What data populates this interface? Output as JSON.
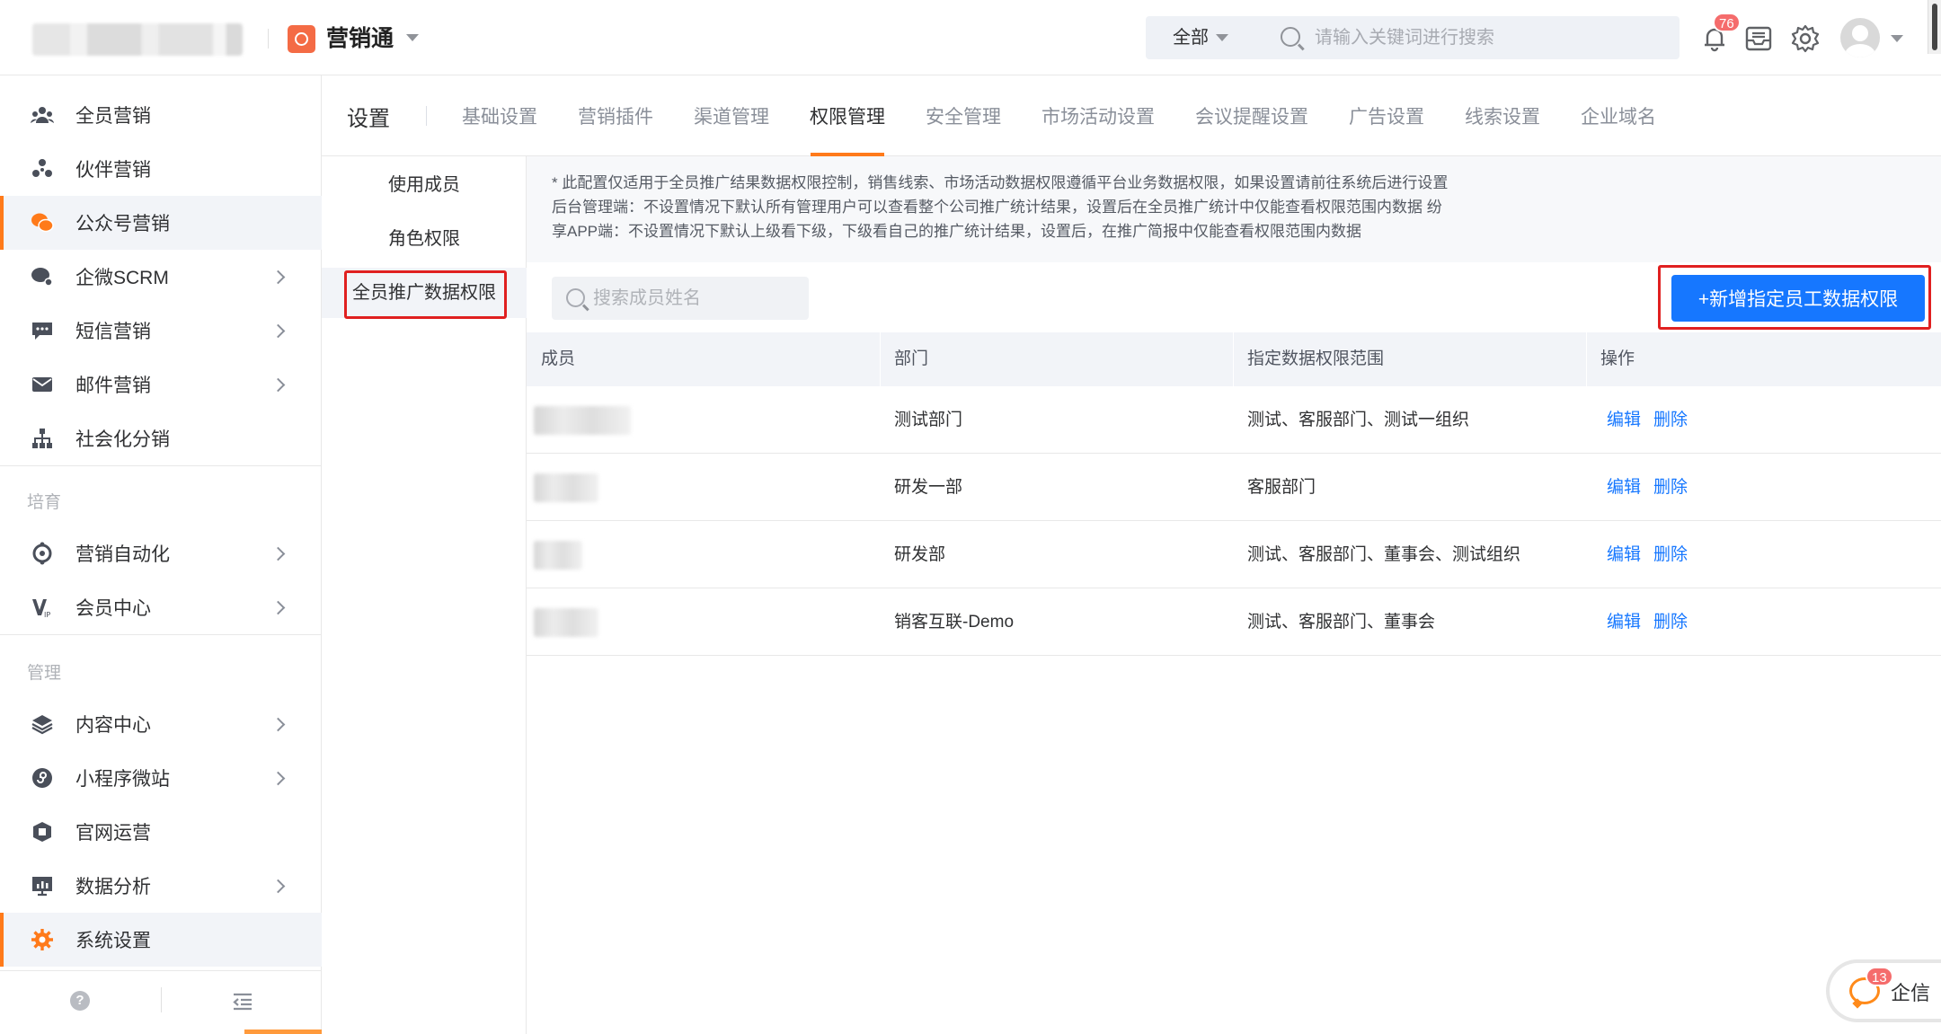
{
  "header": {
    "app_name": "营销通",
    "search": {
      "scope": "全部",
      "placeholder": "请输入关键词进行搜索"
    },
    "notification_count": "76"
  },
  "sidebar": {
    "items": [
      {
        "label": "全员营销",
        "icon": "people-group-icon",
        "has_arrow": false
      },
      {
        "label": "伙伴营销",
        "icon": "partner-network-icon",
        "has_arrow": false
      },
      {
        "label": "公众号营销",
        "icon": "wechat-icon",
        "has_arrow": false,
        "active": true
      },
      {
        "label": "企微SCRM",
        "icon": "wecom-chat-icon",
        "has_arrow": true
      },
      {
        "label": "短信营销",
        "icon": "sms-icon",
        "has_arrow": true
      },
      {
        "label": "邮件营销",
        "icon": "mail-icon",
        "has_arrow": true
      },
      {
        "label": "社会化分销",
        "icon": "hierarchy-icon",
        "has_arrow": false
      }
    ],
    "group_nurture": "培育",
    "nurture_items": [
      {
        "label": "营销自动化",
        "icon": "automation-icon",
        "has_arrow": true
      },
      {
        "label": "会员中心",
        "icon": "vip-icon",
        "has_arrow": true
      }
    ],
    "group_manage": "管理",
    "manage_items": [
      {
        "label": "内容中心",
        "icon": "layers-icon",
        "has_arrow": true
      },
      {
        "label": "小程序微站",
        "icon": "miniprogram-icon",
        "has_arrow": true
      },
      {
        "label": "官网运营",
        "icon": "website-icon",
        "has_arrow": false
      },
      {
        "label": "数据分析",
        "icon": "monitor-chart-icon",
        "has_arrow": true
      },
      {
        "label": "系统设置",
        "icon": "gear-icon",
        "has_arrow": false,
        "active": true
      }
    ]
  },
  "tabs": {
    "title": "设置",
    "items": [
      "基础设置",
      "营销插件",
      "渠道管理",
      "权限管理",
      "安全管理",
      "市场活动设置",
      "会议提醒设置",
      "广告设置",
      "线索设置",
      "企业域名"
    ],
    "active": "权限管理"
  },
  "submenu": {
    "items": [
      "使用成员",
      "角色权限",
      "全员推广数据权限"
    ],
    "active": "全员推广数据权限"
  },
  "notice": {
    "lines": [
      "* 此配置仅适用于全员推广结果数据权限控制，销售线索、市场活动数据权限遵循平台业务数据权限，如果设置请前往系统后进行设置",
      "后台管理端：不设置情况下默认所有管理用户可以查看整个公司推广统计结果，设置后在全员推广统计中仅能查看权限范围内数据 纷",
      "享APP端：不设置情况下默认上级看下级，下级看自己的推广统计结果，设置后，在推广简报中仅能查看权限范围内数据"
    ]
  },
  "toolbar": {
    "member_search_placeholder": "搜索成员姓名",
    "add_button": "+新增指定员工数据权限"
  },
  "table": {
    "columns": [
      "成员",
      "部门",
      "指定数据权限范围",
      "操作"
    ],
    "rows": [
      {
        "member": "",
        "dept": "测试部门",
        "scope": "测试、客服部门、测试一组织"
      },
      {
        "member": "",
        "dept": "研发一部",
        "scope": "客服部门"
      },
      {
        "member": "",
        "dept": "研发部",
        "scope": "测试、客服部门、董事会、测试组织"
      },
      {
        "member": "",
        "dept": "销客互联-Demo",
        "scope": "测试、客服部门、董事会"
      }
    ],
    "edit_label": "编辑",
    "delete_label": "删除"
  },
  "chat_widget": {
    "label": "企信",
    "count": "13"
  },
  "colors": {
    "accent": "#ff7a1a",
    "primary": "#1677ff",
    "highlight_box": "#e02020",
    "badge": "#f56c6c"
  }
}
